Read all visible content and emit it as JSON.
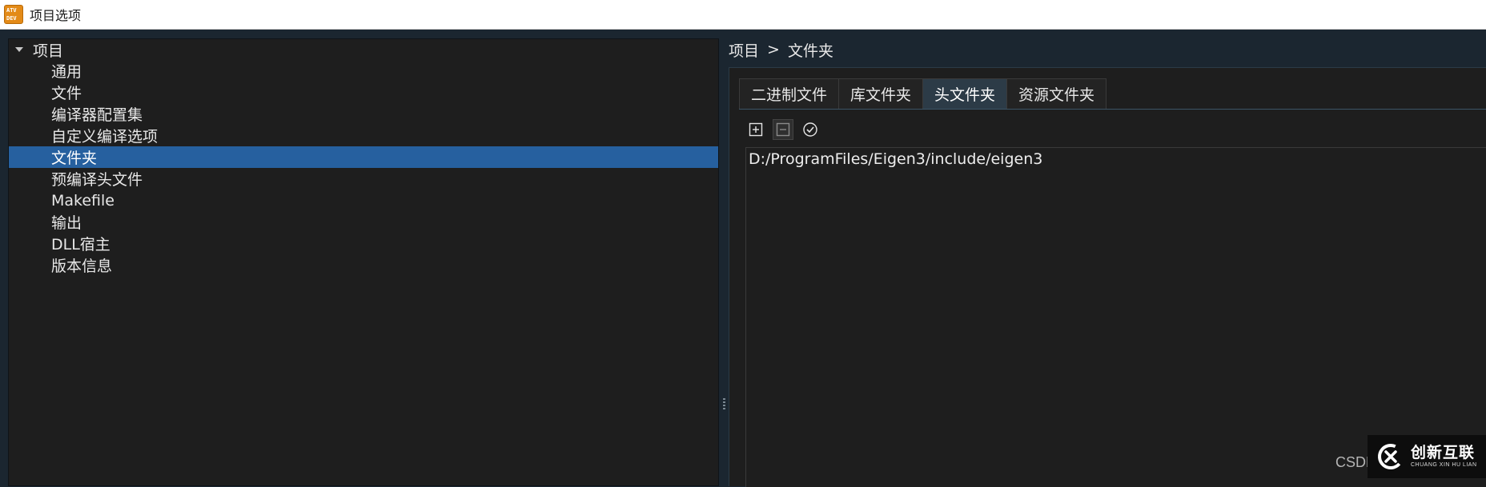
{
  "window": {
    "title": "项目选项",
    "icon_text_top": "ATV",
    "icon_text_bottom": "DEV"
  },
  "tree": {
    "root_label": "项目",
    "items": [
      {
        "label": "通用",
        "selected": false
      },
      {
        "label": "文件",
        "selected": false
      },
      {
        "label": "编译器配置集",
        "selected": false
      },
      {
        "label": "自定义编译选项",
        "selected": false
      },
      {
        "label": "文件夹",
        "selected": true
      },
      {
        "label": "预编译头文件",
        "selected": false
      },
      {
        "label": "Makefile",
        "selected": false
      },
      {
        "label": "输出",
        "selected": false
      },
      {
        "label": "DLL宿主",
        "selected": false
      },
      {
        "label": "版本信息",
        "selected": false
      }
    ]
  },
  "breadcrumb": {
    "parent": "项目",
    "separator": ">",
    "current": "文件夹"
  },
  "tabs": [
    {
      "label": "二进制文件",
      "active": false
    },
    {
      "label": "库文件夹",
      "active": false
    },
    {
      "label": "头文件夹",
      "active": true
    },
    {
      "label": "资源文件夹",
      "active": false
    }
  ],
  "toolbar": {
    "add_icon": "plus-box-icon",
    "remove_icon": "minus-box-icon",
    "check_icon": "check-circle-icon"
  },
  "folders": [
    "D:/ProgramFiles/Eigen3/include/eigen3"
  ],
  "watermark": {
    "text": "CSDN",
    "logo_cn": "创新互联",
    "logo_en": "CHUANG XIN HU LIAN"
  },
  "colors": {
    "selection": "#26609f",
    "panel_bg": "#1e1e1e",
    "window_bg": "#1b2630",
    "active_tab": "#2c3b47",
    "icon_orange": "#e38a17"
  }
}
